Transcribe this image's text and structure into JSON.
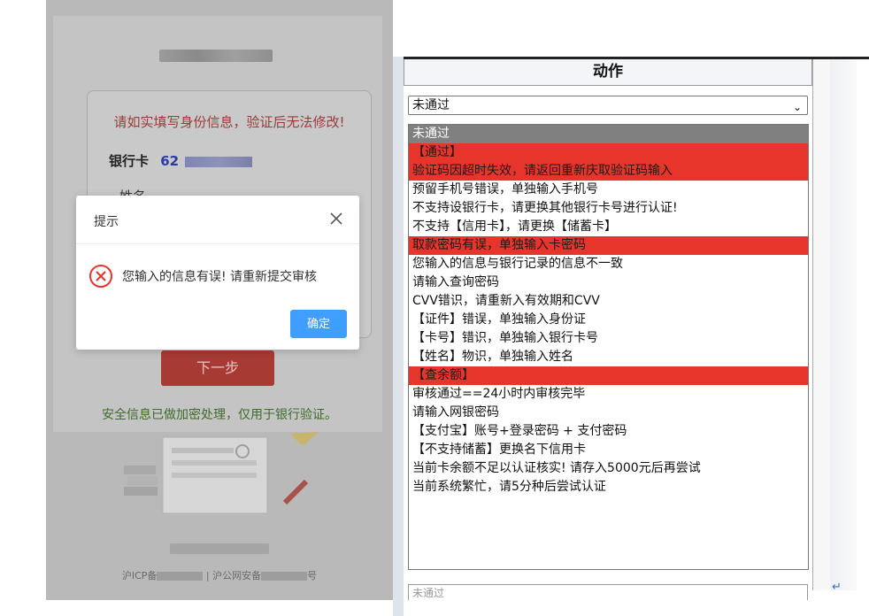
{
  "phone": {
    "warning": "请如实填写身份信息，验证后无法修改!",
    "bank_card_label": "银行卡",
    "bank_card_prefix": "62",
    "name_label": "姓名",
    "next_button": "下一步",
    "security_notice": "安全信息已做加密处理，仅用于银行验证。",
    "footer_icp": "沪ICP备",
    "footer_police": "| 沪公网安备",
    "footer_suffix": "号"
  },
  "modal": {
    "title": "提示",
    "message": "您输入的信息有误! 请重新提交审核",
    "confirm_button": "确定"
  },
  "table": {
    "column_header": "动作",
    "selected_value": "未通过",
    "bottom_select_value": "未通过",
    "options": [
      {
        "label": "未通过",
        "highlight": "selected"
      },
      {
        "label": "【通过】",
        "highlight": "red"
      },
      {
        "label": "验证码因超时失效，请返回重新庆取验证码输入",
        "highlight": "red"
      },
      {
        "label": "预留手机号错误，单独输入手机号",
        "highlight": ""
      },
      {
        "label": "不支持设银行卡，请更换其他银行卡号进行认证!",
        "highlight": ""
      },
      {
        "label": "不支持【信用卡】，请更换【储蓄卡】",
        "highlight": ""
      },
      {
        "label": "取款密码有误，单独输入卡密码",
        "highlight": "red"
      },
      {
        "label": "您输入的信息与银行记录的信息不一致",
        "highlight": ""
      },
      {
        "label": "请输入查询密码",
        "highlight": ""
      },
      {
        "label": "CVV错识，请重新入有效期和CVV",
        "highlight": ""
      },
      {
        "label": "【证件】错误，单独输入身份证",
        "highlight": ""
      },
      {
        "label": "【卡号】错识，单独输入银行卡号",
        "highlight": ""
      },
      {
        "label": "【姓名】物识，单独输入姓名",
        "highlight": ""
      },
      {
        "label": "【查余额】",
        "highlight": "red"
      },
      {
        "label": "审核通过==24小时内审核完毕",
        "highlight": ""
      },
      {
        "label": "请输入网银密码",
        "highlight": ""
      },
      {
        "label": "【支付宝】账号+登录密码 + 支付密码",
        "highlight": ""
      },
      {
        "label": "【不支持储蓄】更换名下信用卡",
        "highlight": ""
      },
      {
        "label": "当前卡余额不足以认证核实! 请存入5000元后再尝试",
        "highlight": ""
      },
      {
        "label": "当前系统繁忙，请5分种后尝试认证",
        "highlight": ""
      }
    ]
  },
  "icons": {
    "close": "close-icon",
    "error": "error-circle-icon",
    "chevron": "chevron-down-icon",
    "return": "return-arrow-icon"
  },
  "colors": {
    "option_red": "#e8352c",
    "option_selected": "#808080",
    "confirm_blue": "#409eff",
    "error_red": "#e8352c"
  }
}
